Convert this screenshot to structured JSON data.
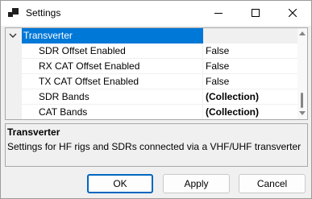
{
  "window": {
    "title": "Settings",
    "app_icon": "settings-app-icon",
    "controls": [
      "minimize-icon",
      "maximize-icon",
      "close-icon"
    ]
  },
  "property_grid": {
    "category": {
      "label": "Transverter",
      "expanded": true
    },
    "rows": [
      {
        "name": "SDR Offset Enabled",
        "value": "False",
        "bold": false
      },
      {
        "name": "RX CAT Offset Enabled",
        "value": "False",
        "bold": false
      },
      {
        "name": "TX CAT Offset Enabled",
        "value": "False",
        "bold": false
      },
      {
        "name": "SDR Bands",
        "value": "(Collection)",
        "bold": true
      },
      {
        "name": "CAT Bands",
        "value": "(Collection)",
        "bold": true
      }
    ]
  },
  "help": {
    "title": "Transverter",
    "description": "Settings for HF rigs and SDRs connected via a VHF/UHF transverter"
  },
  "buttons": {
    "ok": "OK",
    "apply": "Apply",
    "cancel": "Cancel"
  },
  "colors": {
    "selection": "#0078d7",
    "default_button_border": "#0067c0"
  }
}
